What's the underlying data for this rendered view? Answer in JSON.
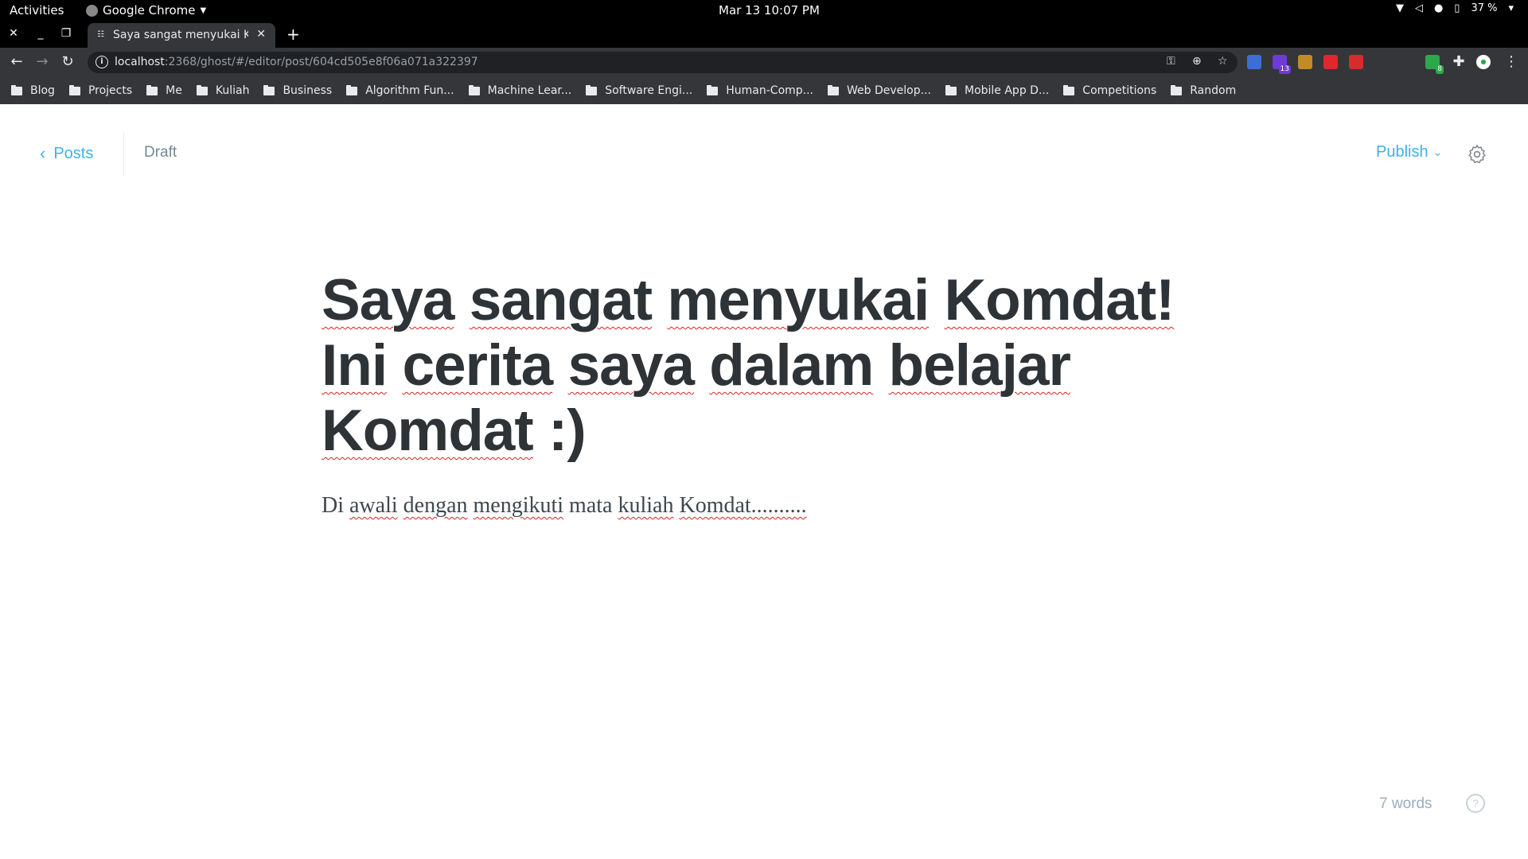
{
  "system_bar": {
    "activities": "Activities",
    "app_name": "Google Chrome",
    "clock": "Mar 13  10:07 PM",
    "battery": "37 %"
  },
  "tab": {
    "title": "Saya sangat menyukai Komdat! Ini cerita saya dalam belajar Komdat :)"
  },
  "omnibox": {
    "url_host": "localhost",
    "url_rest": ":2368/ghost/#/editor/post/604cd505e8f06a071a322397"
  },
  "extensions": [
    {
      "name": "translate-ext-icon",
      "badge": "",
      "color": "#3b6fd6"
    },
    {
      "name": "purple-ext-icon",
      "badge": "13",
      "color": "#6f3bd6"
    },
    {
      "name": "cookie-ext-icon",
      "badge": "",
      "color": "#c48a2a"
    },
    {
      "name": "red-square-ext-icon",
      "badge": "",
      "color": "#e2262f"
    },
    {
      "name": "hand-stop-ext-icon",
      "badge": "",
      "color": "#d62c2c"
    },
    {
      "name": "formula-ext-icon",
      "badge": "",
      "color": "#35363a"
    },
    {
      "name": "orange-ext-icon",
      "badge": "",
      "color": "#35363a"
    },
    {
      "name": "green-ext-icon",
      "badge": "8",
      "color": "#2ca84a"
    }
  ],
  "bookmarks": [
    "Blog",
    "Projects",
    "Me",
    "Kuliah",
    "Business",
    "Algorithm Fun...",
    "Machine Lear...",
    "Software Engi...",
    "Human-Comp...",
    "Web Develop...",
    "Mobile App D...",
    "Competitions",
    "Random"
  ],
  "editor": {
    "back_label": "Posts",
    "status": "Draft",
    "publish_label": "Publish",
    "word_count": "7 words",
    "help_glyph": "?"
  },
  "post": {
    "title_words": [
      "Saya",
      "sangat",
      "menyukai",
      "Komdat!",
      "Ini",
      "cerita",
      "saya",
      "dalam",
      "belajar",
      "Komdat",
      ":)"
    ],
    "body_words": [
      "Di",
      "awali",
      "dengan",
      "mengikuti",
      "mata",
      "kuliah",
      "Komdat.........."
    ]
  },
  "colors": {
    "accent": "#3eb0ef",
    "title_text": "#2e3337",
    "spellcheck": "#e02020"
  }
}
